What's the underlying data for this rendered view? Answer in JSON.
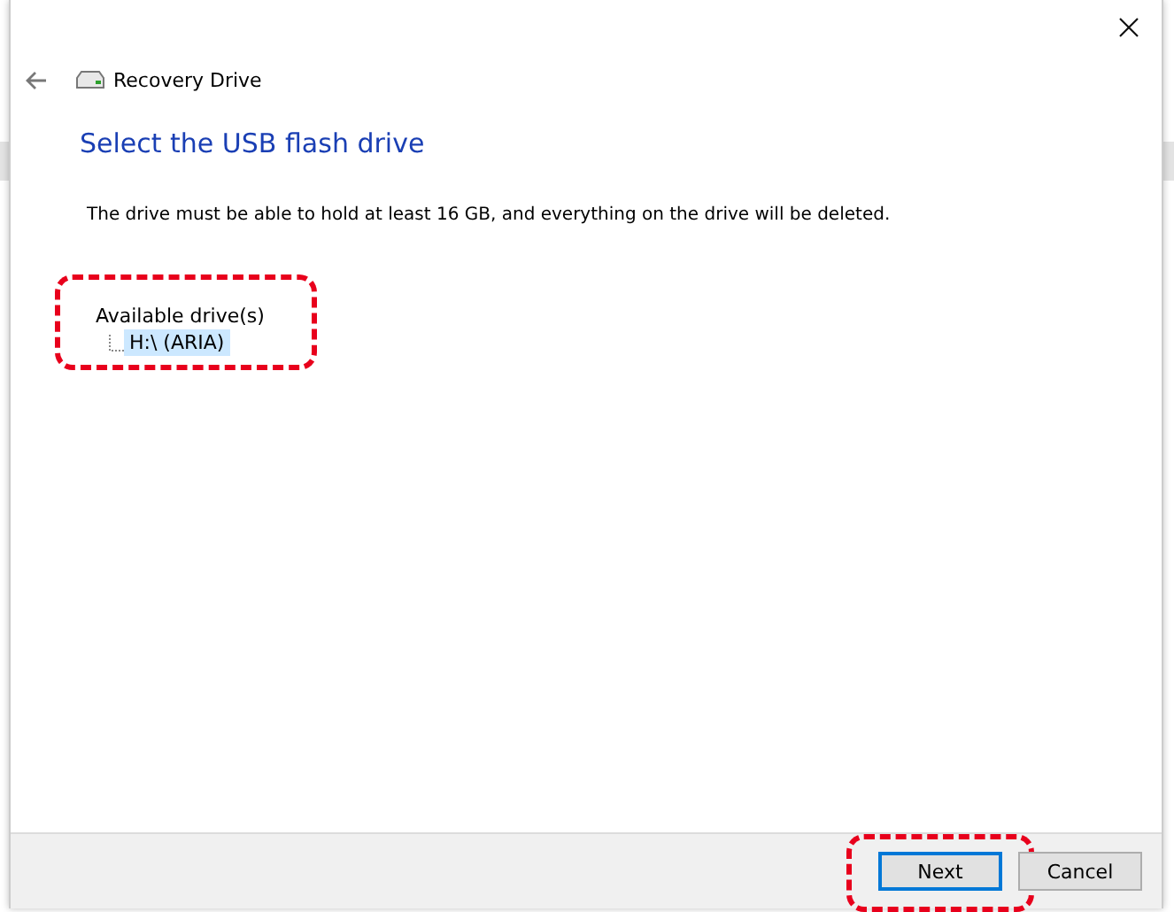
{
  "window": {
    "title": "Recovery Drive"
  },
  "heading": "Select the USB flash drive",
  "description": "The drive must be able to hold at least 16 GB, and everything on the drive will be deleted.",
  "drive_tree": {
    "label": "Available drive(s)",
    "highlighted": true,
    "children": [
      {
        "label": "H:\\ (ARIA)",
        "selected": true
      }
    ]
  },
  "buttons": [
    {
      "label": "Next",
      "focused": true,
      "highlighted": true
    },
    {
      "label": "Cancel",
      "focused": false,
      "highlighted": false
    }
  ]
}
